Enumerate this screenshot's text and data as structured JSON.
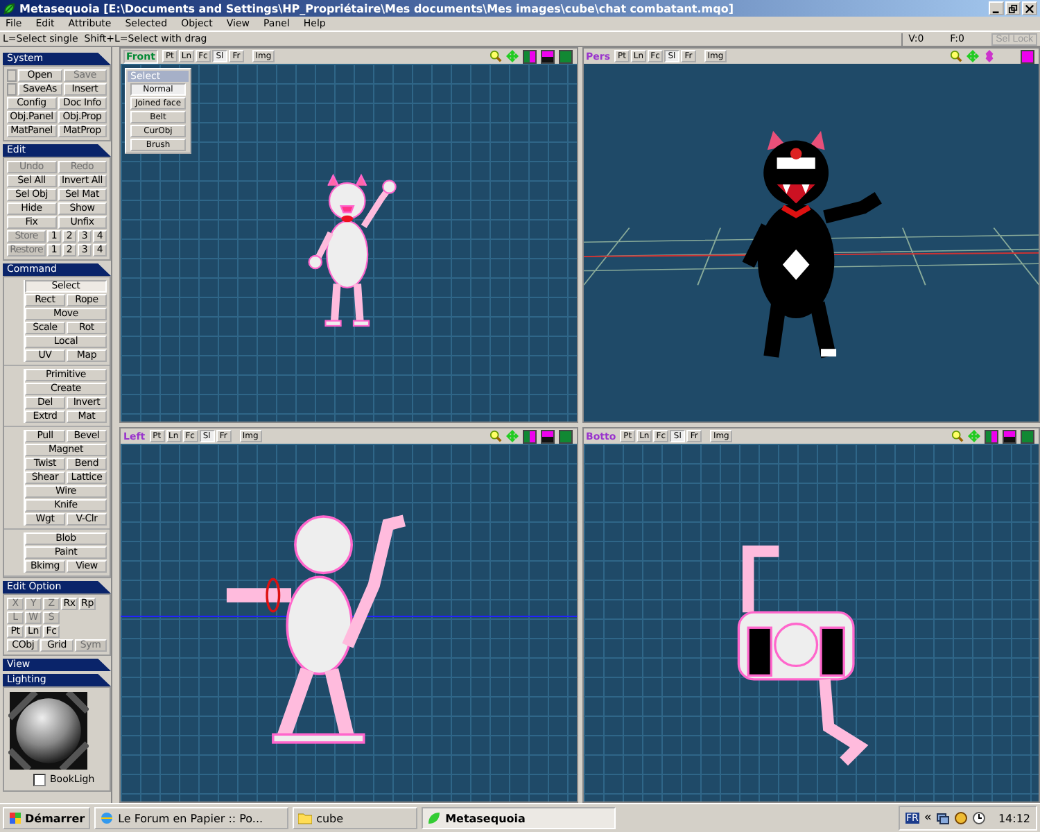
{
  "window": {
    "title": "Metasequoia [E:\\Documents and Settings\\HP_Propriétaire\\Mes documents\\Mes images\\cube\\chat combatant.mqo]"
  },
  "menu": [
    "File",
    "Edit",
    "Attribute",
    "Selected",
    "Object",
    "View",
    "Panel",
    "Help"
  ],
  "status": {
    "hint": "L=Select single  Shift+L=Select with drag",
    "vertices": "V:0",
    "faces": "F:0",
    "lock": "Sel Lock"
  },
  "panels": [
    {
      "title": "System",
      "kind": "system",
      "rows": [
        [
          {
            "label": "Open",
            "disabled": false
          },
          {
            "label": "Save",
            "disabled": true
          }
        ],
        [
          {
            "label": "SaveAs",
            "disabled": false
          },
          {
            "label": "Insert",
            "disabled": false
          }
        ],
        [
          {
            "label": "Config",
            "disabled": false
          },
          {
            "label": "Doc Info",
            "disabled": false
          }
        ],
        [
          {
            "label": "Obj.Panel",
            "disabled": false
          },
          {
            "label": "Obj.Prop",
            "disabled": false
          }
        ],
        [
          {
            "label": "MatPanel",
            "disabled": false
          },
          {
            "label": "MatProp",
            "disabled": false
          }
        ]
      ]
    },
    {
      "title": "Edit",
      "kind": "plain",
      "rows": [
        [
          {
            "label": "Undo",
            "disabled": true
          },
          {
            "label": "Redo",
            "disabled": true
          }
        ],
        [
          {
            "label": "Sel All",
            "disabled": false
          },
          {
            "label": "Invert All",
            "disabled": false
          }
        ],
        [
          {
            "label": "Sel Obj",
            "disabled": false
          },
          {
            "label": "Sel Mat",
            "disabled": false
          }
        ],
        [
          {
            "label": "Hide",
            "disabled": false
          },
          {
            "label": "Show",
            "disabled": false
          }
        ],
        [
          {
            "label": "Fix",
            "disabled": false
          },
          {
            "label": "Unfix",
            "disabled": false
          }
        ],
        [
          {
            "label": "Store",
            "disabled": true
          },
          {
            "label": "1",
            "disabled": false
          },
          {
            "label": "2",
            "disabled": false
          },
          {
            "label": "3",
            "disabled": false
          },
          {
            "label": "4",
            "disabled": false
          }
        ],
        [
          {
            "label": "Restore",
            "disabled": true
          },
          {
            "label": "1",
            "disabled": false
          },
          {
            "label": "2",
            "disabled": false
          },
          {
            "label": "3",
            "disabled": false
          },
          {
            "label": "4",
            "disabled": false
          }
        ]
      ]
    },
    {
      "title": "Command",
      "kind": "command",
      "groups": [
        [
          [
            {
              "label": "Select",
              "selected": true
            }
          ],
          [
            {
              "label": "Rect",
              "selected": false
            },
            {
              "label": "Rope",
              "selected": false
            }
          ],
          [
            {
              "label": "Move",
              "selected": false
            }
          ],
          [
            {
              "label": "Scale",
              "selected": false
            },
            {
              "label": "Rot",
              "selected": false
            }
          ],
          [
            {
              "label": "Local",
              "selected": false
            }
          ],
          [
            {
              "label": "UV",
              "selected": false
            },
            {
              "label": "Map",
              "selected": false
            }
          ]
        ],
        [
          [
            {
              "label": "Primitive",
              "selected": false
            }
          ],
          [
            {
              "label": "Create",
              "selected": false
            }
          ],
          [
            {
              "label": "Del",
              "selected": false
            },
            {
              "label": "Invert",
              "selected": false
            }
          ],
          [
            {
              "label": "Extrd",
              "selected": false
            },
            {
              "label": "Mat",
              "selected": false
            }
          ]
        ],
        [
          [
            {
              "label": "Pull",
              "selected": false
            },
            {
              "label": "Bevel",
              "selected": false
            }
          ],
          [
            {
              "label": "Magnet",
              "selected": false
            }
          ],
          [
            {
              "label": "Twist",
              "selected": false
            },
            {
              "label": "Bend",
              "selected": false
            }
          ],
          [
            {
              "label": "Shear",
              "selected": false
            },
            {
              "label": "Lattice",
              "selected": false
            }
          ],
          [
            {
              "label": "Wire",
              "selected": false
            }
          ],
          [
            {
              "label": "Knife",
              "selected": false
            }
          ],
          [
            {
              "label": "Wgt",
              "selected": false
            },
            {
              "label": "V-Clr",
              "selected": false
            }
          ]
        ],
        [
          [
            {
              "label": "Blob",
              "selected": false
            }
          ],
          [
            {
              "label": "Paint",
              "selected": false
            }
          ],
          [
            {
              "label": "Bkimg",
              "selected": false
            },
            {
              "label": "View",
              "selected": false
            }
          ]
        ]
      ]
    },
    {
      "title": "Edit Option",
      "kind": "options",
      "rows": [
        [
          {
            "label": "X",
            "disabled": true
          },
          {
            "label": "Y",
            "disabled": true
          },
          {
            "label": "Z",
            "disabled": true
          },
          {
            "label": "Rx",
            "disabled": false
          },
          {
            "label": "Rp",
            "disabled": false
          }
        ],
        [
          {
            "label": "L",
            "disabled": true
          },
          {
            "label": "W",
            "disabled": true
          },
          {
            "label": "S",
            "disabled": true
          }
        ],
        [
          {
            "label": "Pt",
            "disabled": false
          },
          {
            "label": "Ln",
            "disabled": false
          },
          {
            "label": "Fc",
            "disabled": false
          }
        ]
      ],
      "switches": [
        {
          "label": "CObj",
          "disabled": false
        },
        {
          "label": "Grid",
          "disabled": false
        },
        {
          "label": "Sym",
          "disabled": true
        }
      ]
    },
    {
      "title": "View",
      "kind": "header"
    },
    {
      "title": "Lighting",
      "kind": "lighting",
      "checkbox": {
        "label": "BookLigh",
        "checked": false
      }
    }
  ],
  "viewports": [
    {
      "label": "Front",
      "kind": "front",
      "selected": true,
      "toggles": [
        {
          "label": "Pt",
          "on": false
        },
        {
          "label": "Ln",
          "on": false
        },
        {
          "label": "Fc",
          "on": false
        },
        {
          "label": "Sl",
          "on": true
        },
        {
          "label": "Fr",
          "on": false
        }
      ],
      "img": "Img",
      "palette": {
        "title": "Select",
        "items": [
          {
            "label": "Normal",
            "selected": true
          },
          {
            "label": "Joined face",
            "selected": false
          },
          {
            "label": "Belt",
            "selected": false
          },
          {
            "label": "CurObj",
            "selected": false
          },
          {
            "label": "Brush",
            "selected": false
          }
        ]
      }
    },
    {
      "label": "Pers",
      "kind": "pers",
      "selected": false,
      "toggles": [
        {
          "label": "Pt",
          "on": false
        },
        {
          "label": "Ln",
          "on": false
        },
        {
          "label": "Fc",
          "on": false
        },
        {
          "label": "Sl",
          "on": true
        },
        {
          "label": "Fr",
          "on": false
        }
      ],
      "img": "Img"
    },
    {
      "label": "Left",
      "kind": "left",
      "selected": false,
      "toggles": [
        {
          "label": "Pt",
          "on": false
        },
        {
          "label": "Ln",
          "on": false
        },
        {
          "label": "Fc",
          "on": false
        },
        {
          "label": "Sl",
          "on": true
        },
        {
          "label": "Fr",
          "on": false
        }
      ],
      "img": "Img"
    },
    {
      "label": "Botto",
      "kind": "bottom",
      "selected": false,
      "toggles": [
        {
          "label": "Pt",
          "on": false
        },
        {
          "label": "Ln",
          "on": false
        },
        {
          "label": "Fc",
          "on": false
        },
        {
          "label": "Sl",
          "on": true
        },
        {
          "label": "Fr",
          "on": false
        }
      ],
      "img": "Img"
    }
  ],
  "taskbar": {
    "start": "Démarrer",
    "tasks": [
      {
        "label": "Le Forum en Papier :: Po...",
        "kind": "browser",
        "selected": false
      },
      {
        "label": "cube",
        "kind": "folder",
        "selected": false
      },
      {
        "label": "Metasequoia",
        "kind": "app",
        "selected": true
      }
    ],
    "lang": "FR",
    "chevron": "«",
    "time": "14:12"
  }
}
